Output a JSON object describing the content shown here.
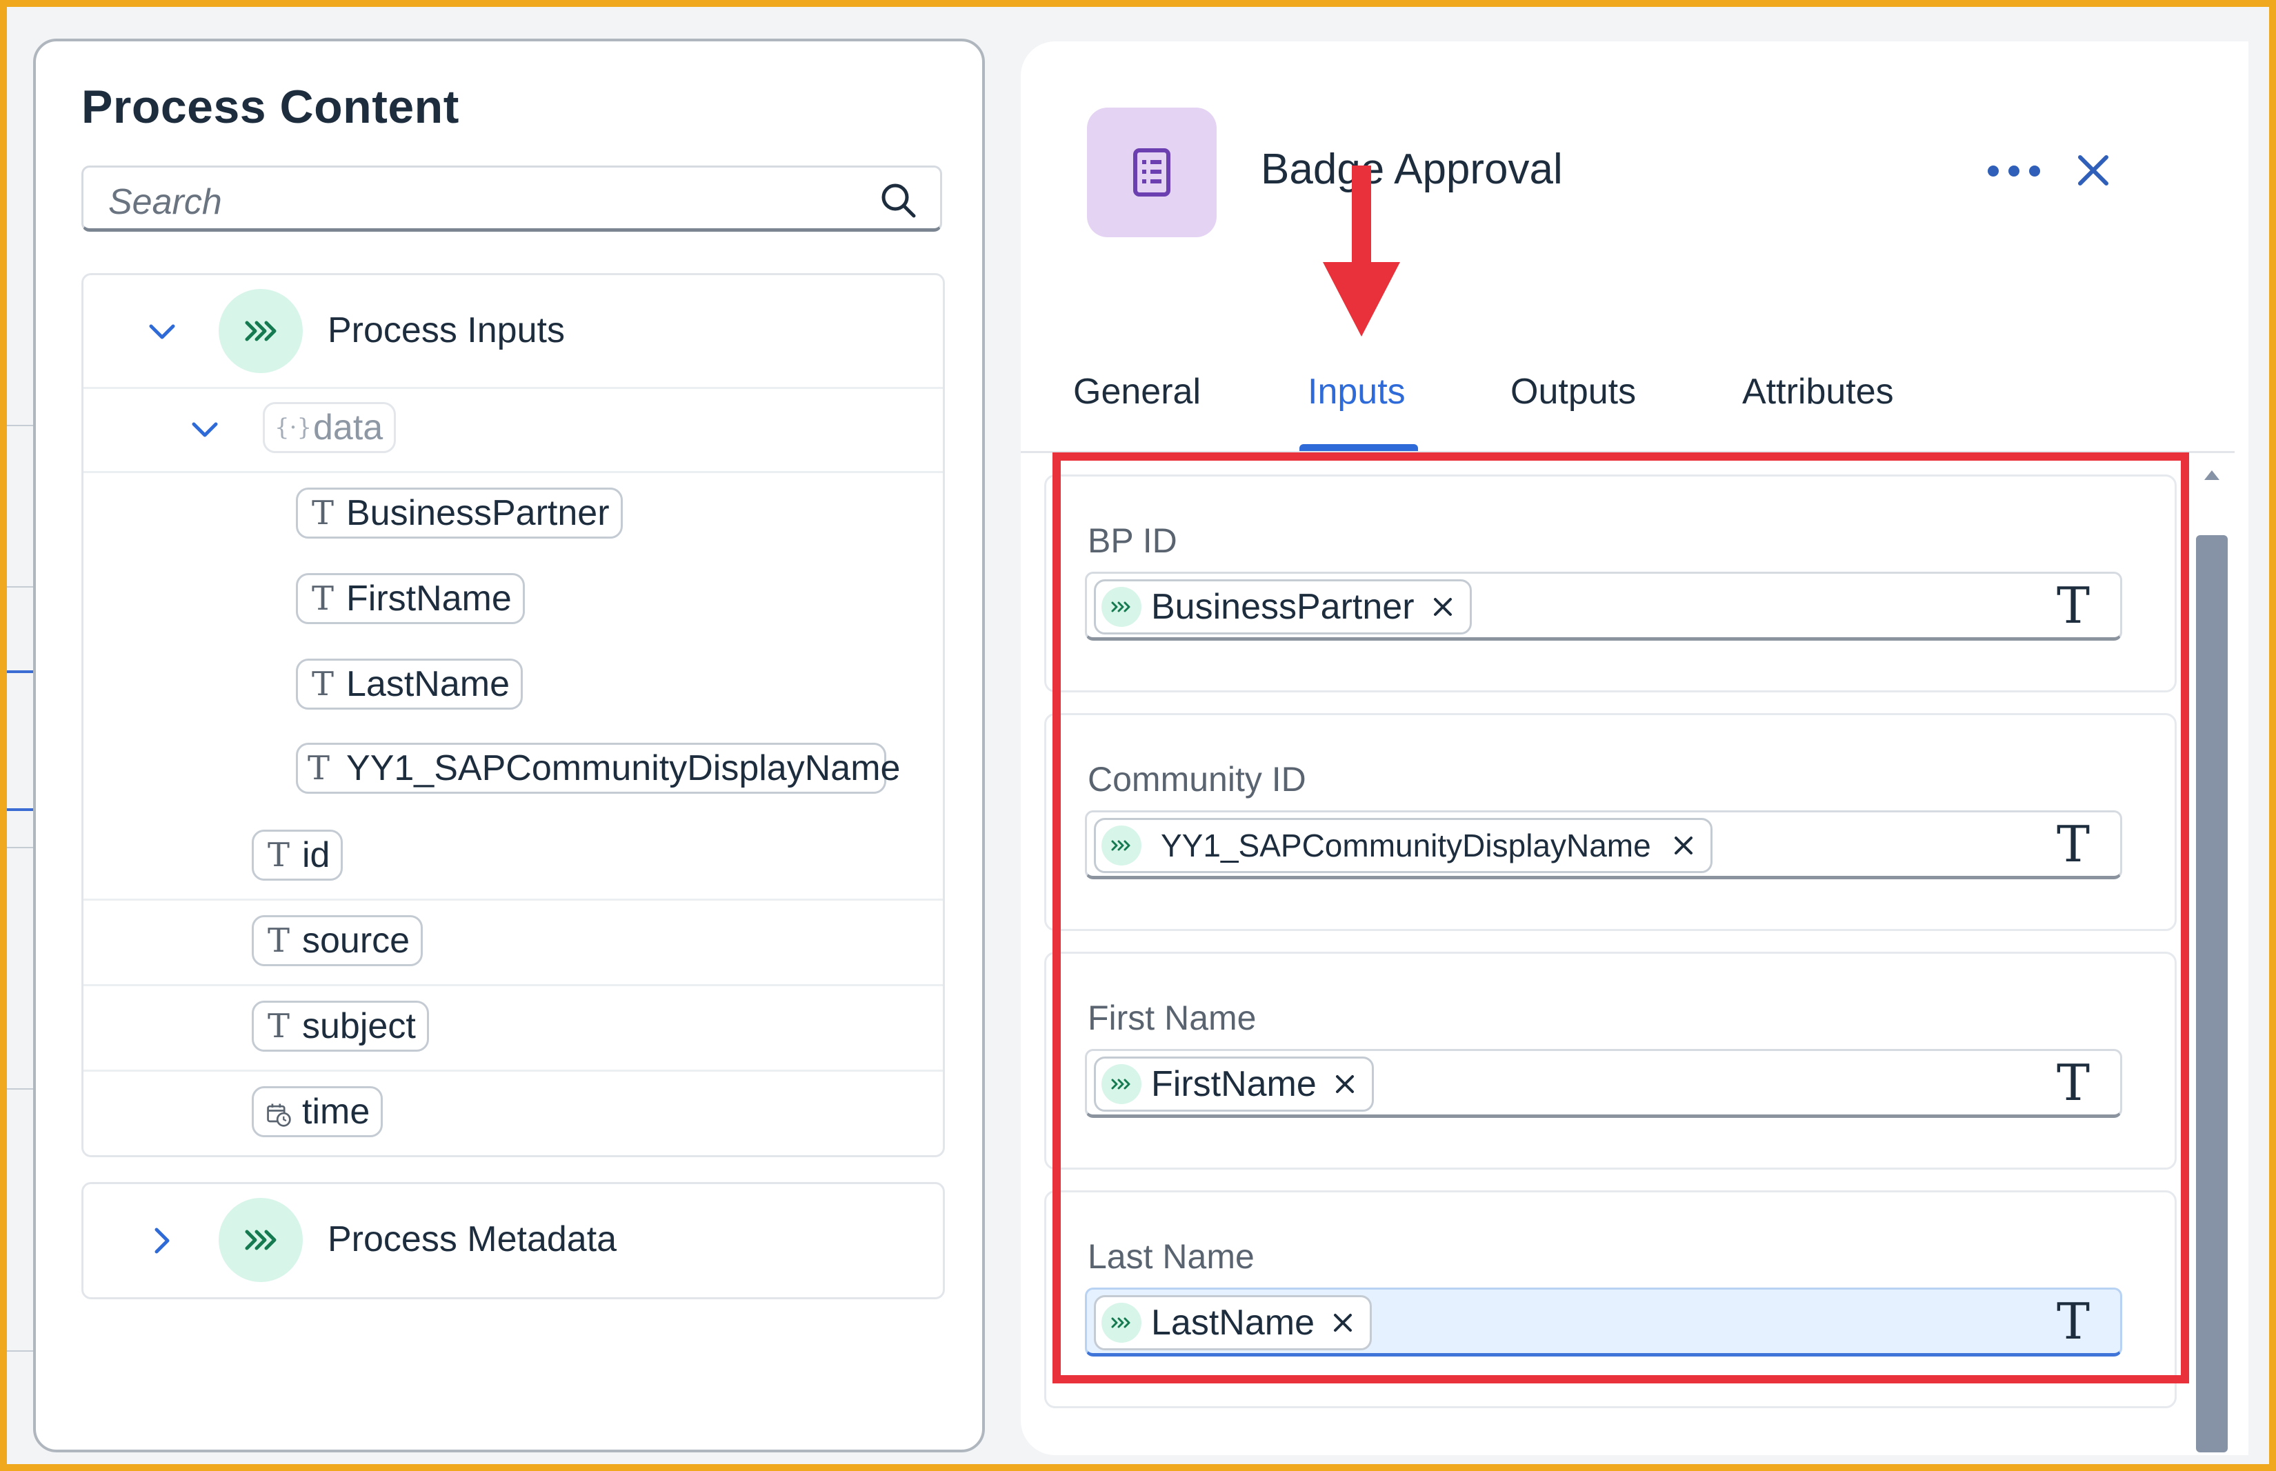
{
  "left_panel": {
    "title": "Process Content",
    "search": {
      "placeholder": "Search"
    },
    "process_inputs": {
      "label": "Process Inputs",
      "data_node": "data",
      "data_fields": [
        "BusinessPartner",
        "FirstName",
        "LastName",
        "YY1_SAPCommunityDisplayName"
      ],
      "fields": [
        "id",
        "source",
        "subject",
        "time"
      ]
    },
    "process_metadata": {
      "label": "Process Metadata"
    }
  },
  "right_panel": {
    "title": "Badge Approval",
    "tabs": [
      "General",
      "Inputs",
      "Outputs",
      "Attributes"
    ],
    "active_tab": "Inputs",
    "fields": [
      {
        "label": "BP ID",
        "value": "BusinessPartner",
        "type_icon": "T"
      },
      {
        "label": "Community ID",
        "value": "YY1_SAPCommunityDisplayName",
        "type_icon": "T"
      },
      {
        "label": "First Name",
        "value": "FirstName",
        "type_icon": "T"
      },
      {
        "label": "Last Name",
        "value": "LastName",
        "type_icon": "T"
      }
    ]
  },
  "icons": {
    "search": "search-icon",
    "expand": "chevron-down-icon",
    "collapse": "chevron-right-icon",
    "process": "process-arrows-icon",
    "data": "data-object-icon",
    "text_type": "text-type-icon",
    "time_type": "date-time-icon",
    "form": "form-icon",
    "more": "more-icon",
    "close": "close-icon",
    "remove": "remove-token-icon"
  },
  "colors": {
    "frame": "#f0a81e",
    "accent": "#2f6bd8",
    "process_icon_bg": "#d8f5ea",
    "form_icon_bg": "#e4d3f3",
    "annotation": "#e8313b"
  }
}
